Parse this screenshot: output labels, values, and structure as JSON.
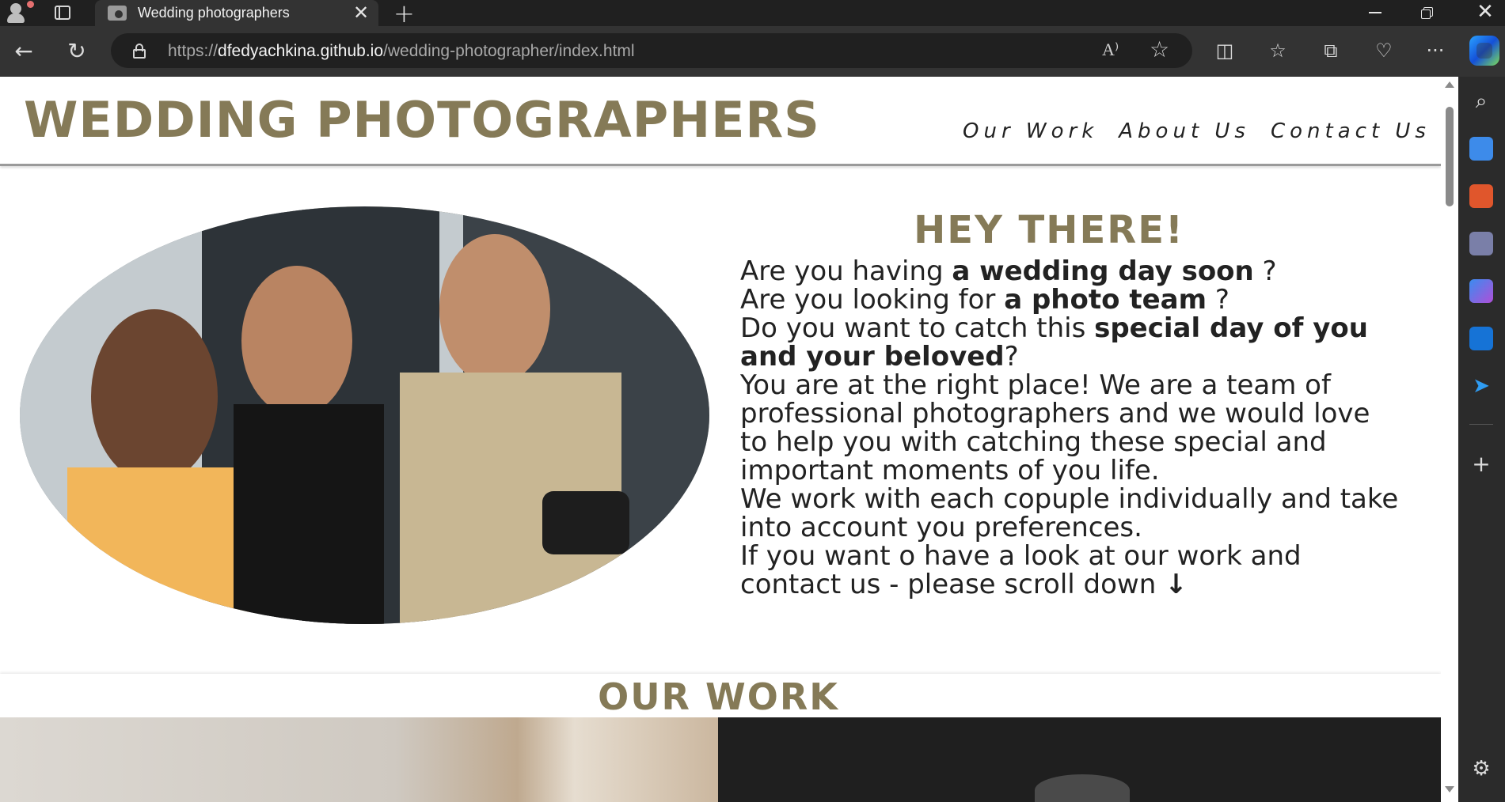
{
  "browser": {
    "tab_title": "Wedding photographers",
    "new_tab_label": "+",
    "url_prefix": "https://",
    "url_host": "dfedyachkina.github.io",
    "url_path": "/wedding-photographer/index.html",
    "read_aloud_label": "A⁾"
  },
  "site": {
    "logo": "WEDDING PHOTOGRAPHERS",
    "nav": [
      "Our Work",
      "About Us",
      "Contact Us"
    ],
    "hero_heading": "HEY THERE!",
    "q1_pre": "Are you having ",
    "q1_bold": "a wedding day soon",
    "q1_post": " ?",
    "q2_pre": "Are you looking for ",
    "q2_bold": "a photo team",
    "q2_post": " ?",
    "q3_pre": "Do you want to catch this ",
    "q3_bold": "special day of you and your beloved",
    "q3_post": "?",
    "paragraph1": "You are at the right place! We are a team of professional photographers and we would love to help you with catching these special and important moments of you life.",
    "paragraph2": "We work with each copuple individually and take into account you preferences.",
    "paragraph3": "If you want o have a look at our work and contact us - please scroll down",
    "scroll_arrow": "🡫",
    "our_work_heading": "OUR WORK"
  },
  "colors": {
    "brand_gold": "#857a57",
    "chrome_dark": "#202020",
    "chrome_mid": "#333333"
  }
}
